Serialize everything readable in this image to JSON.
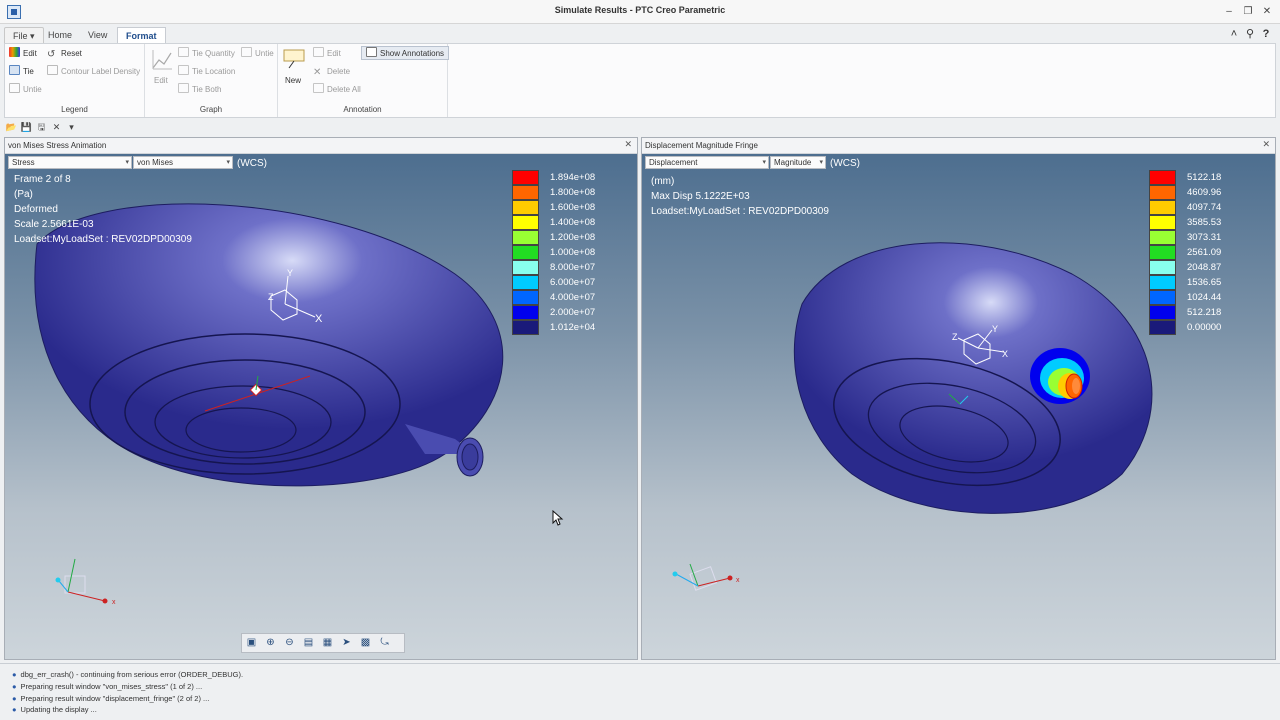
{
  "window": {
    "title": "Simulate Results - PTC Creo Parametric"
  },
  "tabs": {
    "file": "File",
    "home": "Home",
    "view": "View",
    "format": "Format"
  },
  "ribbon": {
    "legend": {
      "label": "Legend",
      "edit": "Edit",
      "reset": "Reset",
      "tie": "Tie",
      "contour": "Contour Label Density",
      "untie": "Untie"
    },
    "graph": {
      "label": "Graph",
      "edit": "Edit",
      "tie_quantity": "Tie Quantity",
      "untie": "Untie",
      "tie_location": "Tie Location",
      "tie_both": "Tie Both"
    },
    "annotation": {
      "label": "Annotation",
      "new": "New",
      "edit": "Edit",
      "show": "Show Annotations",
      "delete": "Delete",
      "delete_all": "Delete All"
    }
  },
  "left_pane": {
    "title": "von Mises Stress Animation",
    "dd1": "Stress",
    "dd2": "von Mises",
    "wcs": "(WCS)",
    "info": [
      "Frame 2 of 8",
      "(Pa)",
      "Deformed",
      "Scale  2.5661E-03",
      "Loadset:MyLoadSet :  REV02DPD00309"
    ],
    "legend_colors": [
      "#ff0000",
      "#ff6600",
      "#ffcc00",
      "#ffff00",
      "#99ff33",
      "#22dd22",
      "#88ffee",
      "#00ccff",
      "#0066ff",
      "#0000ee",
      "#1a1a7a"
    ],
    "legend_values": [
      "1.894e+08",
      "1.800e+08",
      "1.600e+08",
      "1.400e+08",
      "1.200e+08",
      "1.000e+08",
      "8.000e+07",
      "6.000e+07",
      "4.000e+07",
      "2.000e+07",
      "1.012e+04"
    ]
  },
  "right_pane": {
    "title": "Displacement Magnitude Fringe",
    "dd1": "Displacement",
    "dd2": "Magnitude",
    "wcs": "(WCS)",
    "info": [
      "(mm)",
      "Max Disp  5.1222E+03",
      "Loadset:MyLoadSet :  REV02DPD00309"
    ],
    "legend_colors": [
      "#ff0000",
      "#ff6600",
      "#ffcc00",
      "#ffff00",
      "#99ff33",
      "#22dd22",
      "#88ffee",
      "#00ccff",
      "#0066ff",
      "#0000ee",
      "#1a1a7a"
    ],
    "legend_values": [
      "5122.18",
      "4609.96",
      "4097.74",
      "3585.53",
      "3073.31",
      "2561.09",
      "2048.87",
      "1536.65",
      "1024.44",
      "512.218",
      "0.00000"
    ]
  },
  "axes": {
    "x": "X",
    "y": "Y",
    "z": "Z"
  },
  "messages": [
    "dbg_err_crash() - continuing from serious error (ORDER_DEBUG).",
    "Preparing result window \"von_mises_stress\" (1 of 2) ...",
    "Preparing result window \"displacement_fringe\" (2 of 2) ...",
    "Updating the display ..."
  ]
}
